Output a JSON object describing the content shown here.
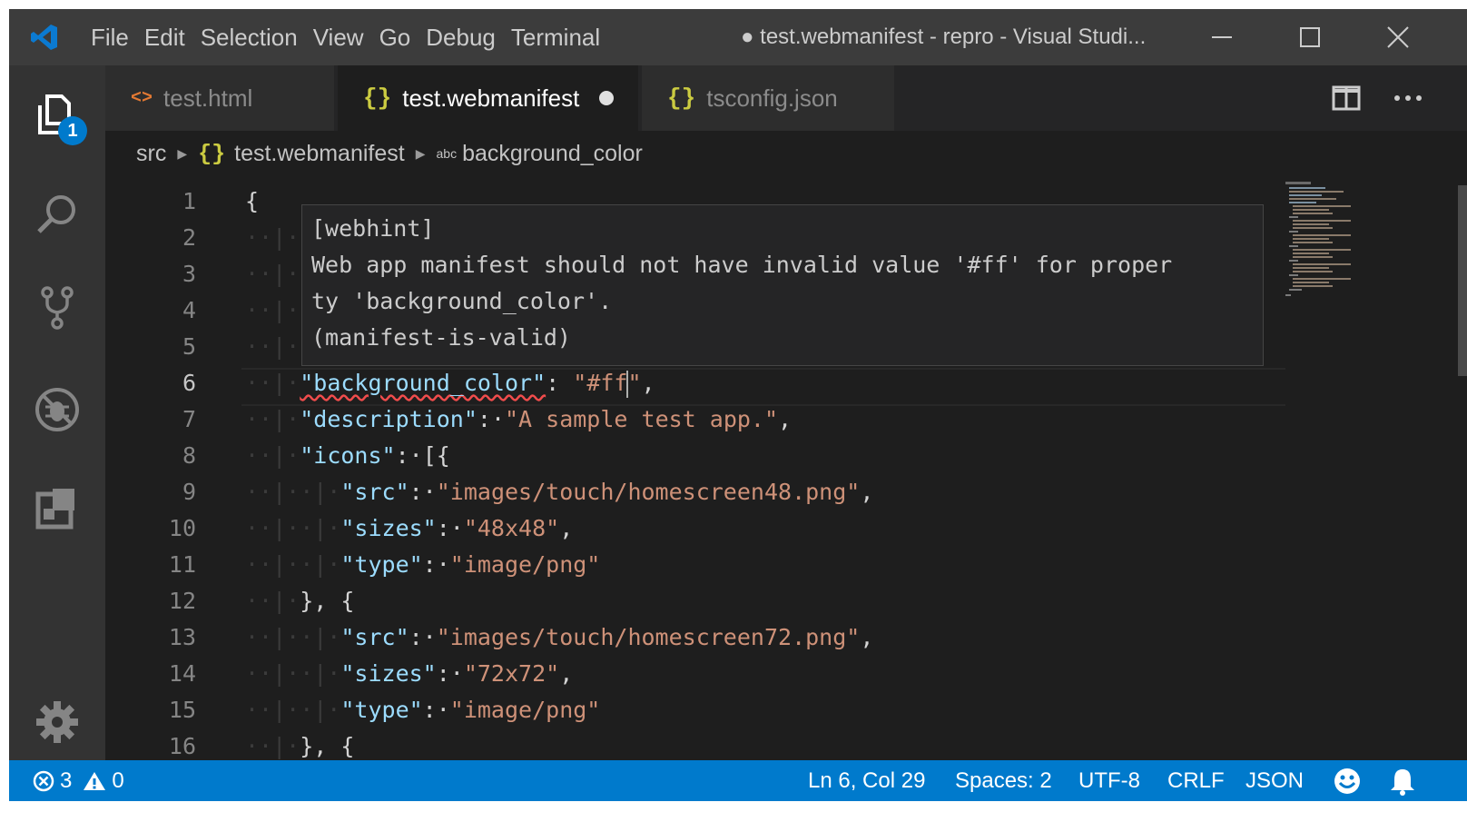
{
  "titlebar": {
    "menu": [
      "File",
      "Edit",
      "Selection",
      "View",
      "Go",
      "Debug",
      "Terminal"
    ],
    "title": "● test.webmanifest - repro - Visual Studi..."
  },
  "activity": {
    "explorer_badge": "1"
  },
  "tabs": [
    {
      "icon": "<>",
      "label": "test.html"
    },
    {
      "icon": "{}",
      "label": "test.webmanifest"
    },
    {
      "icon": "{}",
      "label": "tsconfig.json"
    }
  ],
  "breadcrumb": {
    "folder": "src",
    "file_icon": "{}",
    "file": "test.webmanifest",
    "symbol_icon": "abc",
    "symbol": "background_color"
  },
  "hover": {
    "lines": [
      "[webhint]",
      "Web app manifest should not have invalid value '#ff' for proper",
      "ty 'background_color'.",
      "(manifest-is-valid)"
    ]
  },
  "editor": {
    "line_numbers": [
      "1",
      "2",
      "3",
      "4",
      "5",
      "6",
      "7",
      "8",
      "9",
      "10",
      "11",
      "12",
      "13",
      "14",
      "15",
      "16"
    ],
    "current_line": 6,
    "lines": {
      "l1": "{",
      "l6_key": "\"background_color\"",
      "l6_colon": ": ",
      "l6_val_a": "\"#ff",
      "l6_val_b": "\"",
      "l6_end": ",",
      "l7_key": "\"description\"",
      "l7_val": "\"A sample test app.\"",
      "l8_key": "\"icons\"",
      "l8_rest": "[{",
      "l9_key": "\"src\"",
      "l9_val": "\"images/touch/homescreen48.png\"",
      "l10_key": "\"sizes\"",
      "l10_val": "\"48x48\"",
      "l11_key": "\"type\"",
      "l11_val": "\"image/png\"",
      "l12": "}, {",
      "l13_key": "\"src\"",
      "l13_val": "\"images/touch/homescreen72.png\"",
      "l14_key": "\"sizes\"",
      "l14_val": "\"72x72\"",
      "l15_key": "\"type\"",
      "l15_val": "\"image/png\"",
      "l16": "}, {"
    }
  },
  "statusbar": {
    "errors": "3",
    "warnings": "0",
    "position": "Ln 6, Col 29",
    "spaces": "Spaces: 2",
    "encoding": "UTF-8",
    "eol": "CRLF",
    "language": "JSON"
  },
  "colors": {
    "accent": "#007acc",
    "string": "#ce9178",
    "property": "#9cdcfe",
    "error": "#f14c4c"
  }
}
